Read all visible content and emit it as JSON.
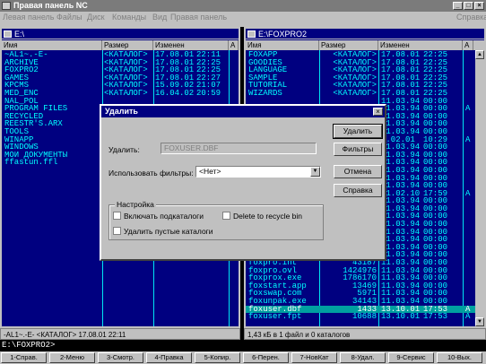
{
  "window": {
    "title": "Правая панель NC"
  },
  "menu": {
    "items": [
      "Левая панель",
      "Файлы",
      "Диск",
      "Команды",
      "Вид",
      "Правая панель"
    ],
    "right": "Справка"
  },
  "left_panel": {
    "path": "E:\\",
    "columns": {
      "name": "Имя",
      "size": "Размер",
      "modified": "Изменен",
      "attr": "A"
    },
    "rows": [
      {
        "name": "~AL1~.-E-",
        "size": "<КАТАЛОГ>",
        "date": "17.08.01",
        "time": "22:11",
        "selected": false
      },
      {
        "name": "ARCHIVE",
        "size": "<КАТАЛОГ>",
        "date": "17.08.01",
        "time": "22:25",
        "selected": false
      },
      {
        "name": "FOXPRO2",
        "size": "<КАТАЛОГ>",
        "date": "17.08.01",
        "time": "22:25",
        "selected": false
      },
      {
        "name": "GAMES",
        "size": "<КАТАЛОГ>",
        "date": "17.08.01",
        "time": "22:27",
        "selected": false
      },
      {
        "name": "KPCMS",
        "size": "<КАТАЛОГ>",
        "date": "15.09.02",
        "time": "21:07",
        "selected": false
      },
      {
        "name": "MED_ENC",
        "size": "<КАТАЛОГ>",
        "date": "16.04.02",
        "time": "20:59",
        "selected": false
      },
      {
        "name": "NAL_POL",
        "size": "",
        "date": "",
        "time": "",
        "selected": false
      },
      {
        "name": "PROGRAM FILES",
        "size": "",
        "date": "",
        "time": "",
        "selected": false
      },
      {
        "name": "RECYCLED",
        "size": "",
        "date": "",
        "time": "",
        "selected": false
      },
      {
        "name": "REESTR'S.ARX",
        "size": "",
        "date": "",
        "time": "",
        "selected": false
      },
      {
        "name": "TOOLS",
        "size": "",
        "date": "",
        "time": "",
        "selected": false
      },
      {
        "name": "WINAPP",
        "size": "",
        "date": "",
        "time": "",
        "selected": false
      },
      {
        "name": "WINDOWS",
        "size": "",
        "date": "",
        "time": "",
        "selected": false
      },
      {
        "name": "МОИ ДОКУМЕНТЫ",
        "size": "",
        "date": "",
        "time": "",
        "selected": false
      },
      {
        "name": "ffastun.ffl",
        "size": "",
        "date": "",
        "time": "",
        "selected": false
      }
    ],
    "status": "-AL1~.-E-  <КАТАЛОГ>  17.08.01 22:11"
  },
  "right_panel": {
    "path": "E:\\FOXPRO2",
    "columns": {
      "name": "Имя",
      "size": "Размер",
      "modified": "Изменен",
      "attr": "A"
    },
    "rows": [
      {
        "name": "FOXAPP",
        "size": "<КАТАЛОГ>",
        "date": "17.08.01",
        "time": "22:25",
        "attr": "",
        "selected": false
      },
      {
        "name": "GOODIES",
        "size": "<КАТАЛОГ>",
        "date": "17.08.01",
        "time": "22:25",
        "attr": "",
        "selected": false
      },
      {
        "name": "LANGUAGE",
        "size": "<КАТАЛОГ>",
        "date": "17.08.01",
        "time": "22:25",
        "attr": "",
        "selected": false
      },
      {
        "name": "SAMPLE",
        "size": "<КАТАЛОГ>",
        "date": "17.08.01",
        "time": "22:25",
        "attr": "",
        "selected": false
      },
      {
        "name": "TUTORIAL",
        "size": "<КАТАЛОГ>",
        "date": "17.08.01",
        "time": "22:25",
        "attr": "",
        "selected": false
      },
      {
        "name": "WIZARDS",
        "size": "<КАТАЛОГ>",
        "date": "17.08.01",
        "time": "22:25",
        "attr": "",
        "selected": false
      },
      {
        "name": "",
        "size": "",
        "date": "11.03.94",
        "time": "00:00",
        "attr": "",
        "selected": false
      },
      {
        "name": "",
        "size": "",
        "date": "11.03.94",
        "time": "00:00",
        "attr": "A",
        "selected": false
      },
      {
        "name": "",
        "size": "",
        "date": "11.03.94",
        "time": "00:00",
        "attr": "",
        "selected": false
      },
      {
        "name": "",
        "size": "",
        "date": "11.03.94",
        "time": "00:00",
        "attr": "",
        "selected": false
      },
      {
        "name": "",
        "size": "",
        "date": "11.03.94",
        "time": "00:00",
        "attr": "",
        "selected": false
      },
      {
        "name": "",
        "size": "",
        "date": "2.02.01",
        "time": "10:29",
        "attr": "A",
        "selected": false
      },
      {
        "name": "",
        "size": "",
        "date": "11.03.94",
        "time": "00:00",
        "attr": "",
        "selected": false
      },
      {
        "name": "",
        "size": "",
        "date": "11.03.94",
        "time": "00:00",
        "attr": "",
        "selected": false
      },
      {
        "name": "",
        "size": "",
        "date": "11.03.94",
        "time": "00:00",
        "attr": "",
        "selected": false
      },
      {
        "name": "",
        "size": "",
        "date": "11.03.94",
        "time": "00:00",
        "attr": "",
        "selected": false
      },
      {
        "name": "",
        "size": "",
        "date": "11.03.94",
        "time": "00:00",
        "attr": "",
        "selected": false
      },
      {
        "name": "",
        "size": "",
        "date": "11.03.94",
        "time": "00:00",
        "attr": "",
        "selected": false
      },
      {
        "name": "",
        "size": "",
        "date": "11.02.10",
        "time": "17:59",
        "attr": "A",
        "selected": false
      },
      {
        "name": "",
        "size": "",
        "date": "11.03.94",
        "time": "00:00",
        "attr": "",
        "selected": false
      },
      {
        "name": "",
        "size": "",
        "date": "11.03.94",
        "time": "00:00",
        "attr": "",
        "selected": false
      },
      {
        "name": "",
        "size": "",
        "date": "11.03.94",
        "time": "00:00",
        "attr": "",
        "selected": false
      },
      {
        "name": "",
        "size": "",
        "date": "11.03.94",
        "time": "00:00",
        "attr": "",
        "selected": false
      },
      {
        "name": "",
        "size": "",
        "date": "11.03.94",
        "time": "00:00",
        "attr": "",
        "selected": false
      },
      {
        "name": "",
        "size": "",
        "date": "11.03.94",
        "time": "00:00",
        "attr": "",
        "selected": false
      },
      {
        "name": "",
        "size": "",
        "date": "11.03.94",
        "time": "00:00",
        "attr": "",
        "selected": false
      },
      {
        "name": "",
        "size": "",
        "date": "11.03.94",
        "time": "00:00",
        "attr": "",
        "selected": false
      },
      {
        "name": "foxpro.int",
        "size": "43187",
        "date": "11.03.94",
        "time": "00:00",
        "attr": "",
        "selected": false
      },
      {
        "name": "foxpro.ovl",
        "size": "1424976",
        "date": "11.03.94",
        "time": "00:00",
        "attr": "",
        "selected": false
      },
      {
        "name": "foxprox.exe",
        "size": "1786170",
        "date": "11.03.94",
        "time": "00:00",
        "attr": "",
        "selected": false
      },
      {
        "name": "foxstart.app",
        "size": "13469",
        "date": "11.03.94",
        "time": "00:00",
        "attr": "",
        "selected": false
      },
      {
        "name": "foxswap.com",
        "size": "5971",
        "date": "11.03.94",
        "time": "00:00",
        "attr": "",
        "selected": false
      },
      {
        "name": "foxunpak.exe",
        "size": "34143",
        "date": "11.03.94",
        "time": "00:00",
        "attr": "",
        "selected": false
      },
      {
        "name": "foxuser.dbf",
        "size": "1433",
        "date": "13.10.01",
        "time": "17:53",
        "attr": "A",
        "selected": true
      },
      {
        "name": "foxuser.fpt",
        "size": "10688",
        "date": "13.10.01",
        "time": "17:53",
        "attr": "A",
        "selected": false
      }
    ],
    "status": "1,43 кБ в 1 файл и 0 каталогов"
  },
  "cmdline": "E:\\FOXPRO2>",
  "fkeys": [
    "1-Справ.",
    "2-Меню",
    "3-Смотр.",
    "4-Правка",
    "5-Копир.",
    "6-Перен.",
    "7-НовКат",
    "8-Удал.",
    "9-Сервис",
    "10-Вых."
  ],
  "dialog": {
    "title": "Удалить",
    "delete_label": "Удалить:",
    "delete_value": "FOXUSER.DBF",
    "filter_label": "Использовать фильтры:",
    "filter_value": "<Нет>",
    "buttons": {
      "delete": "Удалить",
      "filters": "Фильтры",
      "cancel": "Отмена",
      "help": "Справка"
    },
    "group_title": "Настройка",
    "opt_subdirs": "Включать подкаталоги",
    "opt_recycle": "Delete to recycle bin",
    "opt_empty": "Удалить пустые каталоги"
  }
}
